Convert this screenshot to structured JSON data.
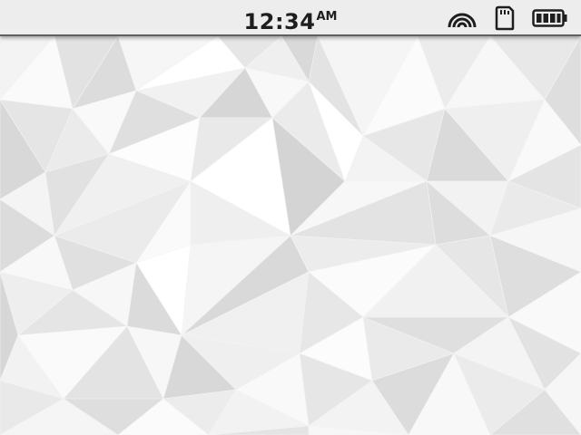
{
  "status_bar": {
    "time": "12:34",
    "ampm": "AM",
    "icons": [
      "wifi-icon",
      "sd-card-icon",
      "battery-icon"
    ],
    "battery_level": 1.0
  },
  "wallpaper": {
    "style": "low-poly white geometric"
  },
  "colors": {
    "status_bar_bg": "#ededed",
    "status_text": "#1e1e1e",
    "status_border": "#5f5f5f"
  }
}
